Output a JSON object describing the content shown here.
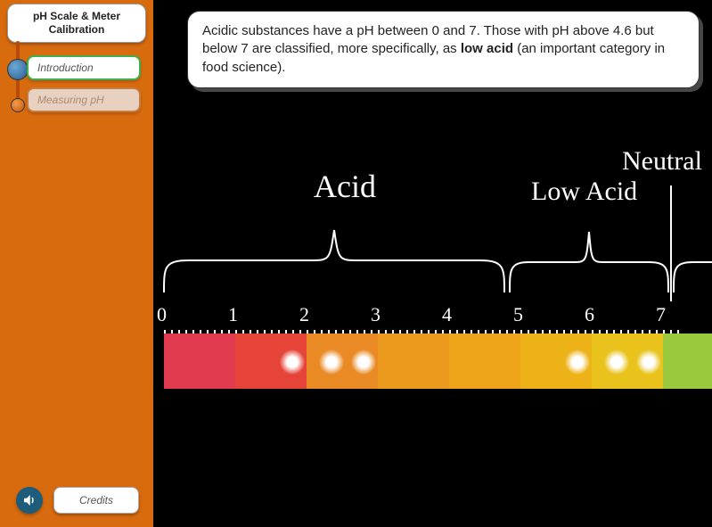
{
  "sidebar": {
    "title": "pH Scale & Meter Calibration",
    "items": [
      {
        "label": "Introduction",
        "active": true
      },
      {
        "label": "Measuring pH",
        "active": false
      }
    ],
    "credits_label": "Credits",
    "sound_icon": "speaker-icon"
  },
  "info": {
    "text_before": "Acidic substances have a pH between 0 and 7. Those with pH above 4.6 but below 7 are classified, more specifically, as ",
    "text_bold": "low acid",
    "text_after": " (an important category in food science)."
  },
  "scale": {
    "labels": {
      "acid": "Acid",
      "low_acid": "Low Acid",
      "neutral": "Neutral"
    },
    "numbers": [
      "0",
      "1",
      "2",
      "3",
      "4",
      "5",
      "6",
      "7"
    ],
    "segments": [
      {
        "ph": 0,
        "color": "#e03a4e"
      },
      {
        "ph": 1,
        "color": "#e64438",
        "glows": [
          50
        ]
      },
      {
        "ph": 2,
        "color": "#ea8a25",
        "glows": [
          14,
          50
        ]
      },
      {
        "ph": 3,
        "color": "#eb9a1e"
      },
      {
        "ph": 4,
        "color": "#eda418"
      },
      {
        "ph": 5,
        "color": "#edb218",
        "glows": [
          50
        ]
      },
      {
        "ph": 6,
        "color": "#e9c21b",
        "glows": [
          14,
          50
        ]
      },
      {
        "ph": 7,
        "color": "#9ac93d"
      }
    ],
    "acid_range": [
      0,
      5
    ],
    "low_acid_range": [
      4.6,
      7
    ],
    "neutral": 7
  }
}
